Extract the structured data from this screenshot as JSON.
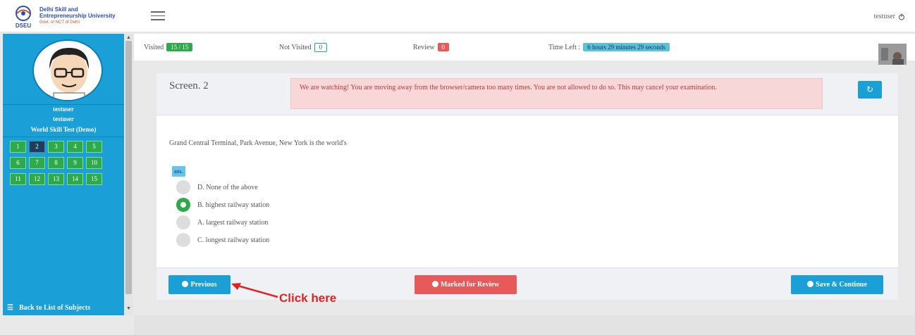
{
  "header": {
    "university_line1": "Delhi Skill and",
    "university_line2": "Entrepreneurship University",
    "university_tagline": "Govt. of NCT of Delhi",
    "logo_text": "DSEU",
    "username": "testuser"
  },
  "sidebar": {
    "user_line1": "testuser",
    "user_line2": "testuser",
    "test_name": "World Skill Test (Demo)",
    "questions": [
      "1",
      "2",
      "3",
      "4",
      "5",
      "6",
      "7",
      "8",
      "9",
      "10",
      "11",
      "12",
      "13",
      "14",
      "15"
    ],
    "current_question": "2",
    "footer_link": "Back to List of Subjects"
  },
  "status": {
    "visited_label": "Visited",
    "visited_value": "15 / 15",
    "not_visited_label": "Not Visited",
    "not_visited_value": "0",
    "review_label": "Review",
    "review_value": "0",
    "time_left_label": "Time Left :",
    "time_left_value": "6 hours 29 minutes 29 seconds"
  },
  "screen": {
    "title": "Screen. 2",
    "warning": "We are watching! You are moving away from the browser/camera too many times. You are not allowed to do so. This may cancel your examination.",
    "question": "Grand Central Terminal, Park Avenue, New York is the world's",
    "answer_tag": "ans.",
    "options": [
      {
        "label": "D. None of the above",
        "checked": false
      },
      {
        "label": "B. highest railway station",
        "checked": true
      },
      {
        "label": "A. largest railway station",
        "checked": false
      },
      {
        "label": "C. longest railway station",
        "checked": false
      }
    ]
  },
  "footer": {
    "previous_label": "Previous",
    "review_label": "Marked for Review",
    "save_label": "Save & Continue"
  },
  "annotation": {
    "text": "Click here"
  },
  "colors": {
    "primary": "#1a9fd6",
    "success": "#2eaa4a",
    "danger": "#e65a5a",
    "info": "#5bc0de"
  }
}
